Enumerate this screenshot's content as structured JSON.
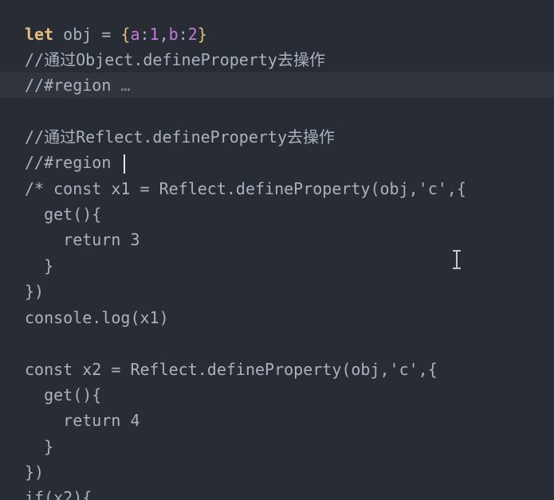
{
  "editor": {
    "lines": [
      {
        "keyword": "let",
        "name": " obj = ",
        "obj_open": "{",
        "k1": "a",
        "sep1": ":",
        "v1": "1",
        "comma": ",",
        "k2": "b",
        "sep2": ":",
        "v2": "2",
        "obj_close": "}"
      },
      {
        "text": "//通过Object.defineProperty去操作"
      },
      {
        "text": "//#region ",
        "fold": "…"
      },
      {
        "text": ""
      },
      {
        "text": "//通过Reflect.defineProperty去操作"
      },
      {
        "text": "//#region "
      },
      {
        "text": "/* const x1 = Reflect.defineProperty(obj,'c',{"
      },
      {
        "text": "  get(){"
      },
      {
        "text": "    return 3"
      },
      {
        "text": "  }"
      },
      {
        "text": "})"
      },
      {
        "text": "console.log(x1)"
      },
      {
        "text": ""
      },
      {
        "text": "const x2 = Reflect.defineProperty(obj,'c',{"
      },
      {
        "text": "  get(){"
      },
      {
        "text": "    return 4"
      },
      {
        "text": "  }"
      },
      {
        "text": "})"
      },
      {
        "text": "if(x2){"
      }
    ]
  },
  "colors": {
    "background": "#282c34",
    "text": "#abb2bf",
    "keyword": "#e5c07b",
    "number": "#c678dd",
    "folded_region_bg": "#30343c"
  }
}
